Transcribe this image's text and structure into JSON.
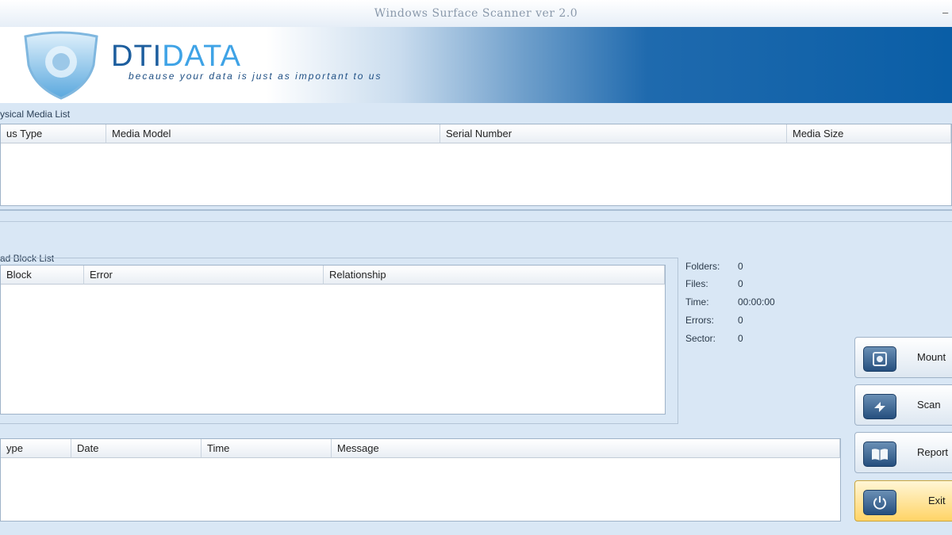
{
  "window": {
    "title": "Windows Surface Scanner ver 2.0",
    "minimize_glyph": "–"
  },
  "brand": {
    "part1": "DTI",
    "part2": "DATA",
    "tagline": "because your data is just as important to us"
  },
  "media_list": {
    "label": "ysical Media List",
    "columns": [
      "us Type",
      "Media Model",
      "Serial Number",
      "Media Size"
    ]
  },
  "bad_block_list": {
    "label": "ad Block List",
    "columns": [
      "Block",
      "Error",
      "Relationship"
    ]
  },
  "stats": {
    "folders_label": "Folders:",
    "folders_value": "0",
    "files_label": "Files:",
    "files_value": "0",
    "time_label": "Time:",
    "time_value": "00:00:00",
    "errors_label": "Errors:",
    "errors_value": "0",
    "sector_label": "Sector:",
    "sector_value": "0"
  },
  "log_list": {
    "columns": [
      "ype",
      "Date",
      "Time",
      "Message"
    ]
  },
  "buttons": {
    "mount": "Mount",
    "scan": "Scan",
    "report": "Report",
    "exit": "Exit"
  },
  "colors": {
    "brand_dark": "#1d5e9e",
    "brand_light": "#3fa3e6",
    "banner_blue": "#0a5ea6",
    "exit_highlight": "#ffd466"
  }
}
